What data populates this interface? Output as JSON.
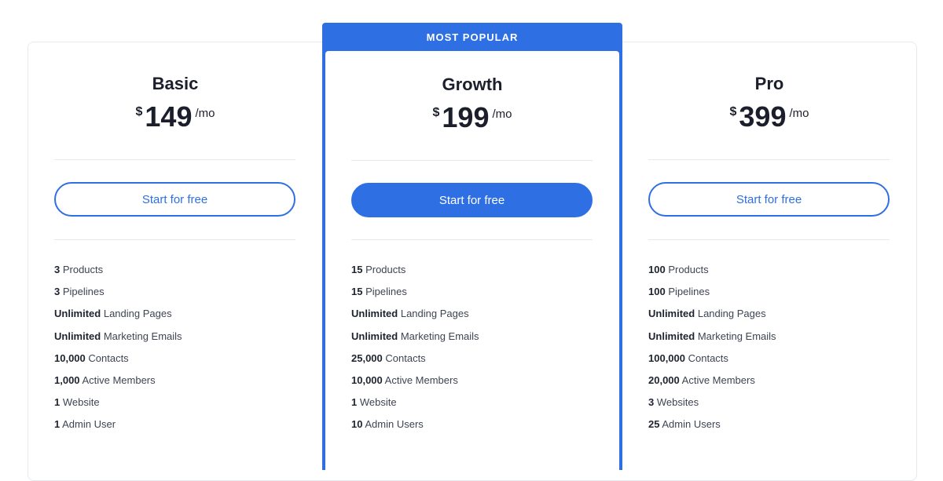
{
  "plans": [
    {
      "name": "Basic",
      "currency": "$",
      "price": "149",
      "period": "/mo",
      "cta": "Start for free",
      "features": [
        {
          "bold": "3",
          "text": " Products"
        },
        {
          "bold": "3",
          "text": " Pipelines"
        },
        {
          "bold": "Unlimited",
          "text": " Landing Pages"
        },
        {
          "bold": "Unlimited",
          "text": " Marketing Emails"
        },
        {
          "bold": "10,000",
          "text": " Contacts"
        },
        {
          "bold": "1,000",
          "text": " Active Members"
        },
        {
          "bold": "1",
          "text": " Website"
        },
        {
          "bold": "1",
          "text": " Admin User"
        }
      ]
    },
    {
      "badge": "MOST POPULAR",
      "name": "Growth",
      "currency": "$",
      "price": "199",
      "period": "/mo",
      "cta": "Start for free",
      "features": [
        {
          "bold": "15",
          "text": " Products"
        },
        {
          "bold": "15",
          "text": " Pipelines"
        },
        {
          "bold": "Unlimited",
          "text": " Landing Pages"
        },
        {
          "bold": "Unlimited",
          "text": " Marketing Emails"
        },
        {
          "bold": "25,000",
          "text": " Contacts"
        },
        {
          "bold": "10,000",
          "text": " Active Members"
        },
        {
          "bold": "1",
          "text": " Website"
        },
        {
          "bold": "10",
          "text": " Admin Users"
        }
      ]
    },
    {
      "name": "Pro",
      "currency": "$",
      "price": "399",
      "period": "/mo",
      "cta": "Start for free",
      "features": [
        {
          "bold": "100",
          "text": " Products"
        },
        {
          "bold": "100",
          "text": " Pipelines"
        },
        {
          "bold": "Unlimited",
          "text": " Landing Pages"
        },
        {
          "bold": "Unlimited",
          "text": " Marketing Emails"
        },
        {
          "bold": "100,000",
          "text": " Contacts"
        },
        {
          "bold": "20,000",
          "text": " Active Members"
        },
        {
          "bold": "3",
          "text": " Websites"
        },
        {
          "bold": "25",
          "text": " Admin Users"
        }
      ]
    }
  ],
  "colors": {
    "accent": "#2f6fe4",
    "border": "#e7e9ee",
    "text": "#1b1f2b"
  }
}
